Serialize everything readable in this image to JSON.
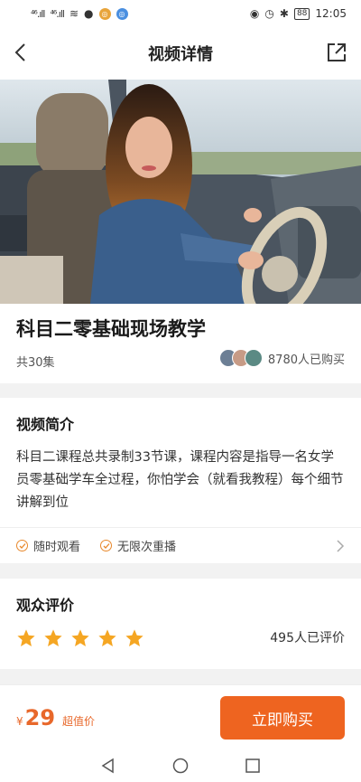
{
  "status_bar": {
    "left_signal_1": "⁴⁶.ıll",
    "left_signal_2": "⁴⁶.ıll",
    "time": "12:05",
    "battery": "88"
  },
  "nav": {
    "title": "视频详情",
    "back_icon": "chevron-left-icon",
    "share_icon": "share-icon"
  },
  "course": {
    "title": "科目二零基础现场教学",
    "episodes": "共30集",
    "buyers": "8780人已购买"
  },
  "intro": {
    "title": "视频简介",
    "text": "科目二课程总共录制33节课，课程内容是指导一名女学员零基础学车全过程，你怕学会（就看我教程）每个细节讲解到位",
    "features": [
      "随时观看",
      "无限次重播"
    ]
  },
  "reviews": {
    "title": "观众评价",
    "rating_stars": 5,
    "max_stars": 5,
    "count": "495人已评价"
  },
  "purchase": {
    "currency": "¥",
    "price": "29",
    "price_tag": "超值价",
    "buy_label": "立即购买"
  },
  "colors": {
    "accent": "#ee6420",
    "star": "#f5a623"
  }
}
